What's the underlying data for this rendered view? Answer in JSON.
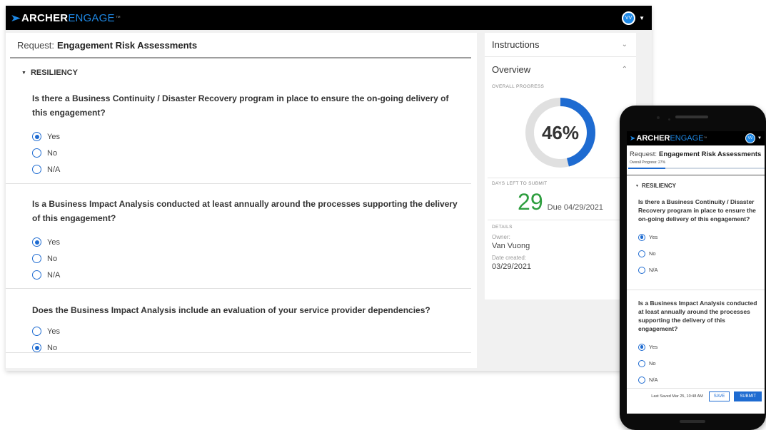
{
  "brand": {
    "bold": "ARCHER",
    "light": "ENGAGE",
    "tm": "™"
  },
  "user": {
    "initials": "VV"
  },
  "request": {
    "label": "Request:",
    "title": "Engagement Risk Assessments"
  },
  "section": "RESILIENCY",
  "questions": [
    {
      "text": "Is there a Business Continuity / Disaster Recovery program in place to ensure the on-going delivery of this engagement?",
      "options": [
        "Yes",
        "No",
        "N/A"
      ],
      "selected": "Yes"
    },
    {
      "text": "Is a Business Impact Analysis conducted at least annually around the processes supporting the delivery of this engagement?",
      "options": [
        "Yes",
        "No",
        "N/A"
      ],
      "selected": "Yes"
    },
    {
      "text": "Does the Business Impact Analysis include an evaluation of your service provider dependencies?",
      "options": [
        "Yes",
        "No"
      ],
      "selected": "No"
    }
  ],
  "sidebar": {
    "instructions": "Instructions",
    "overview": "Overview",
    "overall_progress_label": "OVERALL PROGRESS",
    "progress_value": 46,
    "progress_text": "46%",
    "days_left_label": "DAYS LEFT TO SUBMIT",
    "days_left": "29",
    "due": "Due 04/29/2021",
    "details_label": "DETAILS",
    "owner_label": "Owner:",
    "owner": "Van Vuong",
    "date_created_label": "Date created:",
    "date_created": "03/29/2021"
  },
  "mobile": {
    "overall_progress": "Overall Progress: 27%",
    "progress_value": 27,
    "kebab": "⋮",
    "last_saved": "Last Saved Mar 25, 10:48 AM",
    "save": "SAVE",
    "submit": "SUBMIT"
  },
  "colors": {
    "accent": "#1e6bd1",
    "brand_blue": "#1e88e5",
    "days_green": "#2e9e3f",
    "ring_track": "#e0e0e0"
  },
  "icons": {
    "chevron_down": "⌄",
    "chevron_up": "⌃",
    "section_triangle": "▼",
    "brand_chevron": "➤",
    "user_caret": "▼"
  }
}
